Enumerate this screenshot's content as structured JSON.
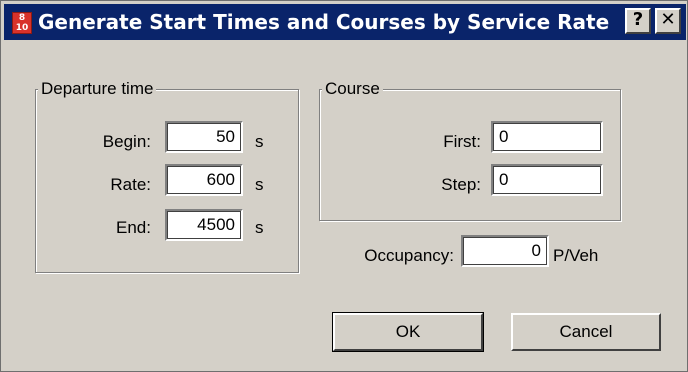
{
  "window": {
    "title": "Generate Start Times and Courses by Service Rate",
    "icon": "timetable-app-icon",
    "icon_text_top": "8",
    "icon_text_bottom": "10",
    "help_label": "?",
    "close_label": "✕"
  },
  "departure": {
    "legend": "Departure time",
    "begin_label": "Begin:",
    "begin_value": "50",
    "rate_label": "Rate:",
    "rate_value": "600",
    "end_label": "End:",
    "end_value": "4500",
    "unit": "s"
  },
  "course": {
    "legend": "Course",
    "first_label": "First:",
    "first_value": "0",
    "step_label": "Step:",
    "step_value": "0"
  },
  "occupancy": {
    "label": "Occupancy:",
    "value": "0",
    "unit": "P/Veh"
  },
  "buttons": {
    "ok": "OK",
    "cancel": "Cancel"
  },
  "colors": {
    "titlebar": "#0a246a",
    "dialog_face": "#d4d0c8",
    "icon_red": "#d8322b"
  }
}
